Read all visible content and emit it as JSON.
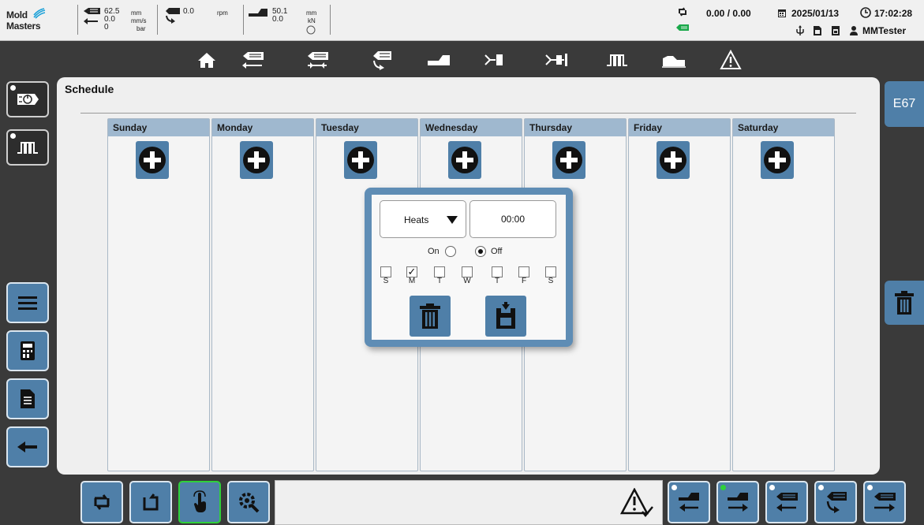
{
  "brand": {
    "line1": "Mold",
    "line2": "Masters"
  },
  "status": {
    "injection": {
      "pos": "62.5",
      "pos_unit": "mm",
      "speed": "0.0",
      "speed_unit": "mm/s",
      "pressure": "0",
      "pressure_unit": "bar"
    },
    "screw": {
      "value": "0.0",
      "unit": "rpm"
    },
    "clamp": {
      "pos": "50.1",
      "pos_unit": "mm",
      "force": "0.0",
      "force_unit": "kN"
    },
    "cycle": "0.00 / 0.00",
    "date": "2025/01/13",
    "time": "17:02:28",
    "user": "MMTester"
  },
  "page": {
    "title": "Schedule"
  },
  "days": [
    {
      "name": "Sunday"
    },
    {
      "name": "Monday"
    },
    {
      "name": "Tuesday"
    },
    {
      "name": "Wednesday"
    },
    {
      "name": "Thursday"
    },
    {
      "name": "Friday"
    },
    {
      "name": "Saturday"
    }
  ],
  "right": {
    "code": "E67"
  },
  "popup": {
    "mode": "Heats",
    "time": "00:00",
    "on_label": "On",
    "off_label": "Off",
    "selected_state": "Off",
    "weekdays": [
      {
        "letter": "S",
        "checked": false
      },
      {
        "letter": "M",
        "checked": true
      },
      {
        "letter": "T",
        "checked": false
      },
      {
        "letter": "W",
        "checked": false
      },
      {
        "letter": "T",
        "checked": false
      },
      {
        "letter": "F",
        "checked": false
      },
      {
        "letter": "S",
        "checked": false
      }
    ],
    "checkmark": "✓"
  },
  "colors": {
    "accent": "#4f7fa8",
    "header": "#9fb8cf",
    "popup_border": "#5f8db5",
    "active": "#2fd13a"
  }
}
